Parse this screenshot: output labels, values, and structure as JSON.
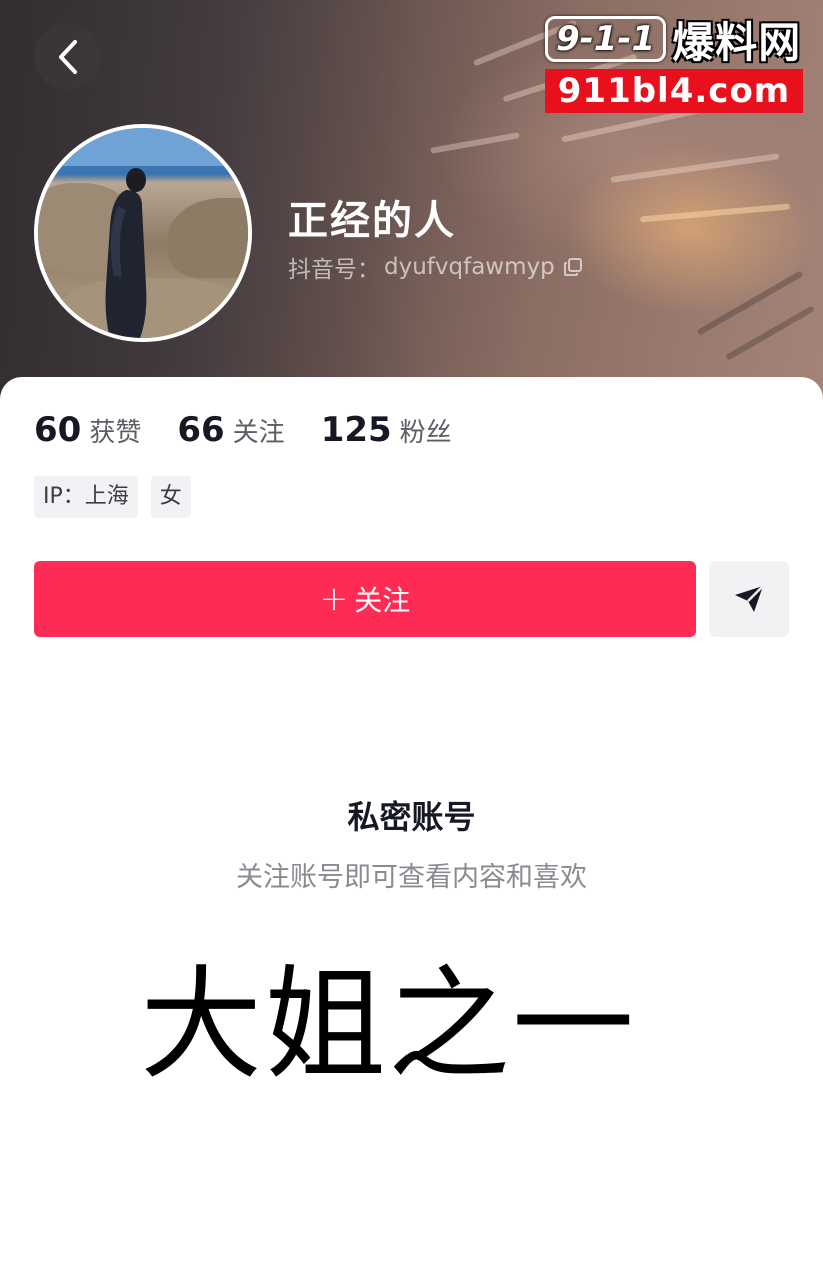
{
  "header": {
    "nickname": "正经的人",
    "id_label": "抖音号：",
    "id_value": "dyufvqfawmyp"
  },
  "watermark": {
    "badge": "9-1-1",
    "name": "爆料网",
    "url": "911bl4.com"
  },
  "stats": [
    {
      "value": "60",
      "label": "获赞"
    },
    {
      "value": "66",
      "label": "关注"
    },
    {
      "value": "125",
      "label": "粉丝"
    }
  ],
  "tags": [
    "IP：上海",
    "女"
  ],
  "actions": {
    "follow_plus": "+",
    "follow_label": "关注"
  },
  "private": {
    "title": "私密账号",
    "subtitle": "关注账号即可查看内容和喜欢"
  },
  "caption": "大姐之一",
  "icons": [
    "back-icon",
    "copy-icon",
    "share-icon"
  ],
  "colors": {
    "follow": "#fe2c55",
    "watermark_red": "#e8101c"
  }
}
